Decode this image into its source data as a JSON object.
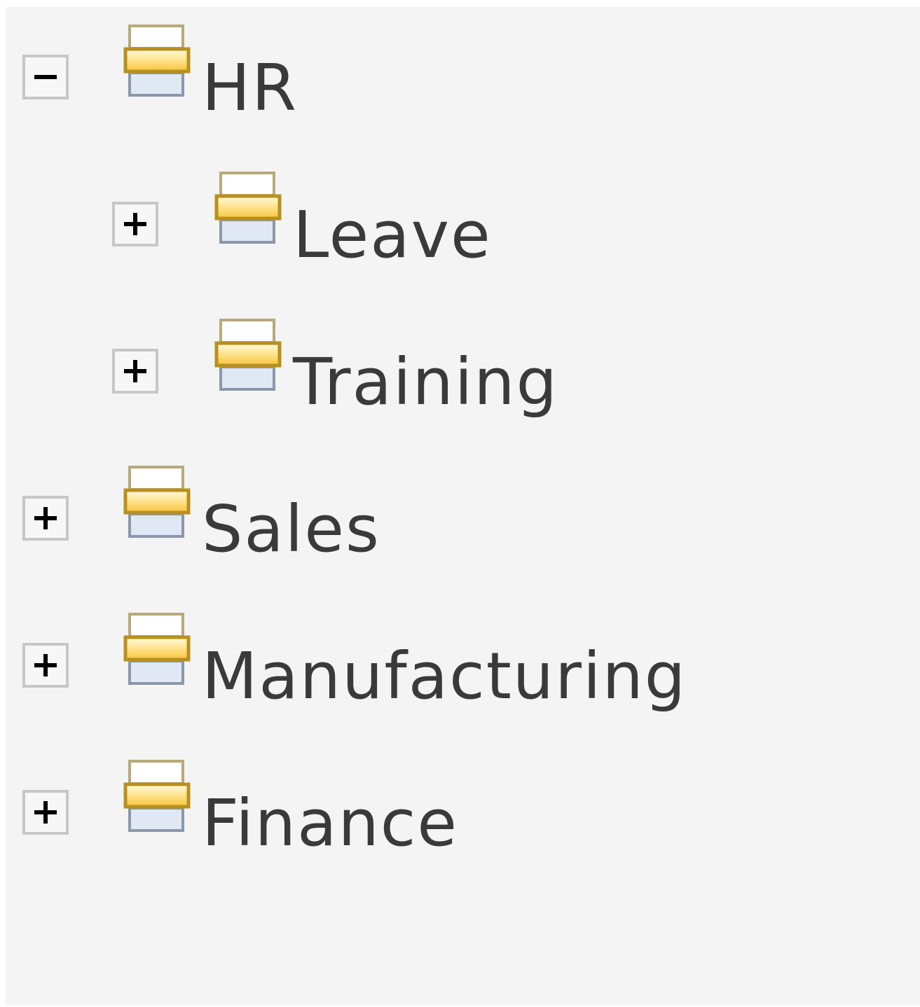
{
  "tree": {
    "nodes": [
      {
        "label": "HR",
        "state": "expanded",
        "icon": "tree-node-icon"
      },
      {
        "label": "Leave",
        "state": "collapsed",
        "icon": "tree-node-icon"
      },
      {
        "label": "Training",
        "state": "collapsed",
        "icon": "tree-node-icon"
      },
      {
        "label": "Sales",
        "state": "collapsed",
        "icon": "tree-node-icon"
      },
      {
        "label": "Manufacturing",
        "state": "collapsed",
        "icon": "tree-node-icon"
      },
      {
        "label": "Finance",
        "state": "collapsed",
        "icon": "tree-node-icon"
      }
    ]
  },
  "colors": {
    "panel_background": "#f4f4f4",
    "text": "#3a3a3a",
    "toggle_border": "#c7c7c7",
    "icon_gold": "#b8901f",
    "icon_blue": "#dde7f3"
  }
}
